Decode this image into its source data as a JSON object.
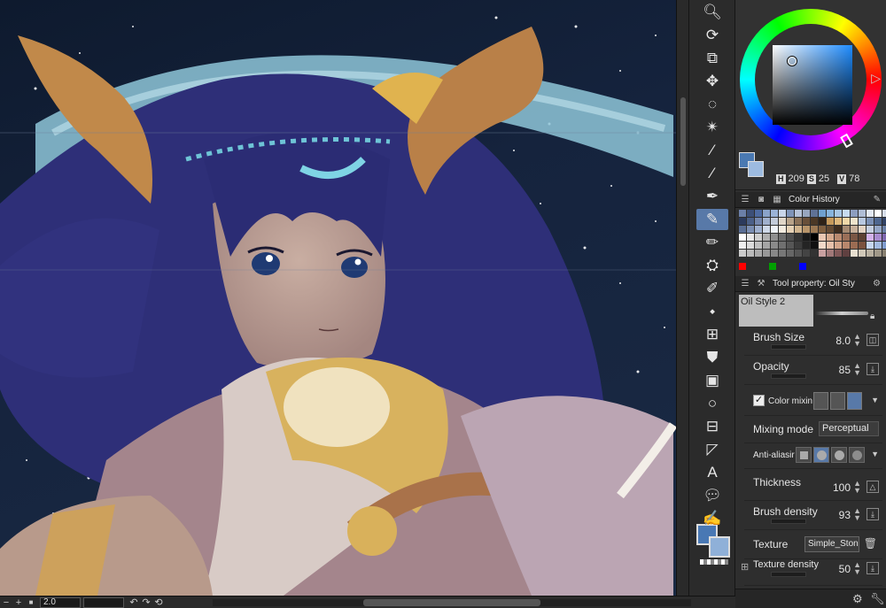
{
  "statusbar": {
    "zoom_out": "−",
    "zoom_in": "+",
    "fit": "■",
    "zoom_value": "2.0",
    "rotate_left": "↶",
    "rotate_right": "↷",
    "reset": "⟲"
  },
  "toolbar": {
    "tools": [
      {
        "name": "zoom-tool",
        "icon": "magnifier-icon",
        "glyph": "🔍︎",
        "active": false
      },
      {
        "name": "rotate-tool",
        "icon": "rotate-icon",
        "glyph": "⟳",
        "active": false
      },
      {
        "name": "operation-tool",
        "icon": "layers-icon",
        "glyph": "⧉",
        "active": false
      },
      {
        "name": "move-tool",
        "icon": "move-icon",
        "glyph": "✥",
        "active": false
      },
      {
        "name": "lasso-tool",
        "icon": "lasso-icon",
        "glyph": "◌",
        "active": false
      },
      {
        "name": "auto-select-tool",
        "icon": "wand-icon",
        "glyph": "✴",
        "active": false
      },
      {
        "name": "eyedropper-tool",
        "icon": "eyedropper-icon",
        "glyph": "⁄",
        "active": false
      },
      {
        "name": "eyedropper-sub-tool",
        "icon": "eyedropper-alt-icon",
        "glyph": "⁄",
        "active": false
      },
      {
        "name": "pen-tool",
        "icon": "pen-icon",
        "glyph": "✒",
        "active": false
      },
      {
        "name": "brush-tool",
        "icon": "brush-icon",
        "glyph": "✎",
        "active": true
      },
      {
        "name": "pencil-tool",
        "icon": "pencil-icon",
        "glyph": "✏",
        "active": false
      },
      {
        "name": "airbrush-tool",
        "icon": "airbrush-icon",
        "glyph": "⛭",
        "active": false
      },
      {
        "name": "decoration-tool",
        "icon": "marker-icon",
        "glyph": "✐",
        "active": false
      },
      {
        "name": "eraser-tool",
        "icon": "eraser-icon",
        "glyph": "⬩",
        "active": false
      },
      {
        "name": "blend-tool",
        "icon": "grid-icon",
        "glyph": "⊞",
        "active": false
      },
      {
        "name": "fill-tool",
        "icon": "bucket-icon",
        "glyph": "⛊",
        "active": false
      },
      {
        "name": "gradient-tool",
        "icon": "gradient-icon",
        "glyph": "▣",
        "active": false
      },
      {
        "name": "figure-tool",
        "icon": "circle-icon",
        "glyph": "○",
        "active": false
      },
      {
        "name": "frame-tool",
        "icon": "frame-icon",
        "glyph": "⊟",
        "active": false
      },
      {
        "name": "ruler-tool",
        "icon": "ruler-icon",
        "glyph": "◸",
        "active": false
      },
      {
        "name": "text-tool",
        "icon": "text-icon",
        "glyph": "A",
        "active": false
      },
      {
        "name": "balloon-tool",
        "icon": "balloon-icon",
        "glyph": "💬︎",
        "active": false
      },
      {
        "name": "correct-line-tool",
        "icon": "line-correct-icon",
        "glyph": "✍",
        "active": false
      }
    ]
  },
  "colors": {
    "main": "#4978b4",
    "sub": "#8fb0d8",
    "accent": "#5879a8"
  },
  "color_wheel": {
    "h_label": "H",
    "h_value": "209",
    "s_label": "S",
    "s_value": "25",
    "v_label": "V",
    "v_value": "78"
  },
  "history_tabs": {
    "label": "Color History"
  },
  "history_colors": [
    "#6b7fa8",
    "#3c4f78",
    "#4e6aa0",
    "#8aa3c9",
    "#9bb3d7",
    "#c9d6ea",
    "#7e93b8",
    "#b5c2d8",
    "#98a6bf",
    "#5f7296",
    "#6fa0cf",
    "#87b4dd",
    "#a7c6e4",
    "#c6dbef",
    "#8d9ec0",
    "#b0bed6",
    "#e2e8f2",
    "#ffffff",
    "#d6dde9",
    "#afc0da",
    "#2c3a5c",
    "#4b5f87",
    "#7486ac",
    "#a0b0cc",
    "#c3cbd9",
    "#e0d6c8",
    "#b7a289",
    "#8a7158",
    "#684f39",
    "#4b3826",
    "#2f2318",
    "#c69a5c",
    "#deb87c",
    "#f0d8a8",
    "#efe4cc",
    "#b8c8e0",
    "#7b90b5",
    "#4e668f",
    "#324366",
    "#1f2a40",
    "#5a6e94",
    "#7b8eb2",
    "#9fb0ce",
    "#cfd9e8",
    "#eef2f7",
    "#f4ece0",
    "#e6d2b6",
    "#d0b48e",
    "#b7946a",
    "#9b7853",
    "#7f5f40",
    "#634a33",
    "#3e2d1f",
    "#a58a72",
    "#c7b09a",
    "#e3d3c3",
    "#c4cee0",
    "#95a7c7",
    "#6b80a7",
    "#46597e",
    "#ffffff",
    "#e8e8e8",
    "#cfcfcf",
    "#b0b0b0",
    "#8f8f8f",
    "#6d6d6d",
    "#4f4f4f",
    "#333333",
    "#1a1a1a",
    "#000000",
    "#e9c7b3",
    "#d5a98e",
    "#b98a70",
    "#9a6f58",
    "#7a5644",
    "#5d4133",
    "#d3b2ea",
    "#a98bd0",
    "#7e67b0",
    "#574890",
    "#f0f0f0",
    "#dcdcdc",
    "#c0c0c0",
    "#a5a5a5",
    "#8a8a8a",
    "#707070",
    "#565656",
    "#3c3c3c",
    "#242424",
    "#111111",
    "#f2d9c9",
    "#e6c1ab",
    "#d2a58b",
    "#b8876d",
    "#9b6c53",
    "#7b533f",
    "#c6d6f0",
    "#a3bbe2",
    "#7f9ccf",
    "#5b7cb8",
    "#cccccc",
    "#bbbbbb",
    "#aaaaaa",
    "#999999",
    "#888888",
    "#777777",
    "#666666",
    "#555555",
    "#444444",
    "#333333",
    "#c8a0a0",
    "#a07878",
    "#805858",
    "#604040",
    "#e8e0d0",
    "#d0c8b8",
    "#b8b0a0",
    "#a09888",
    "#888070",
    "#706858"
  ],
  "history_registered": [
    "#ff0000",
    "#00a000",
    "#0000ff"
  ],
  "tool_property": {
    "tab_label": "Tool property: Oil Sty",
    "preset_name": "Oil Style 2",
    "brush_size_label": "Brush Size",
    "brush_size_value": "8.0",
    "opacity_label": "Opacity",
    "opacity_value": "85",
    "color_mixing_label": "Color mixin",
    "color_mixing_checked": "✓",
    "mixing_mode_label": "Mixing mode",
    "mixing_mode_value": "Perceptual",
    "anti_alias_label": "Anti-aliasir",
    "thickness_label": "Thickness",
    "thickness_value": "100",
    "brush_density_label": "Brush density",
    "brush_density_value": "93",
    "texture_label": "Texture",
    "texture_value": "Simple_Ston",
    "texture_density_label": "Texture density",
    "texture_density_value": "50"
  }
}
